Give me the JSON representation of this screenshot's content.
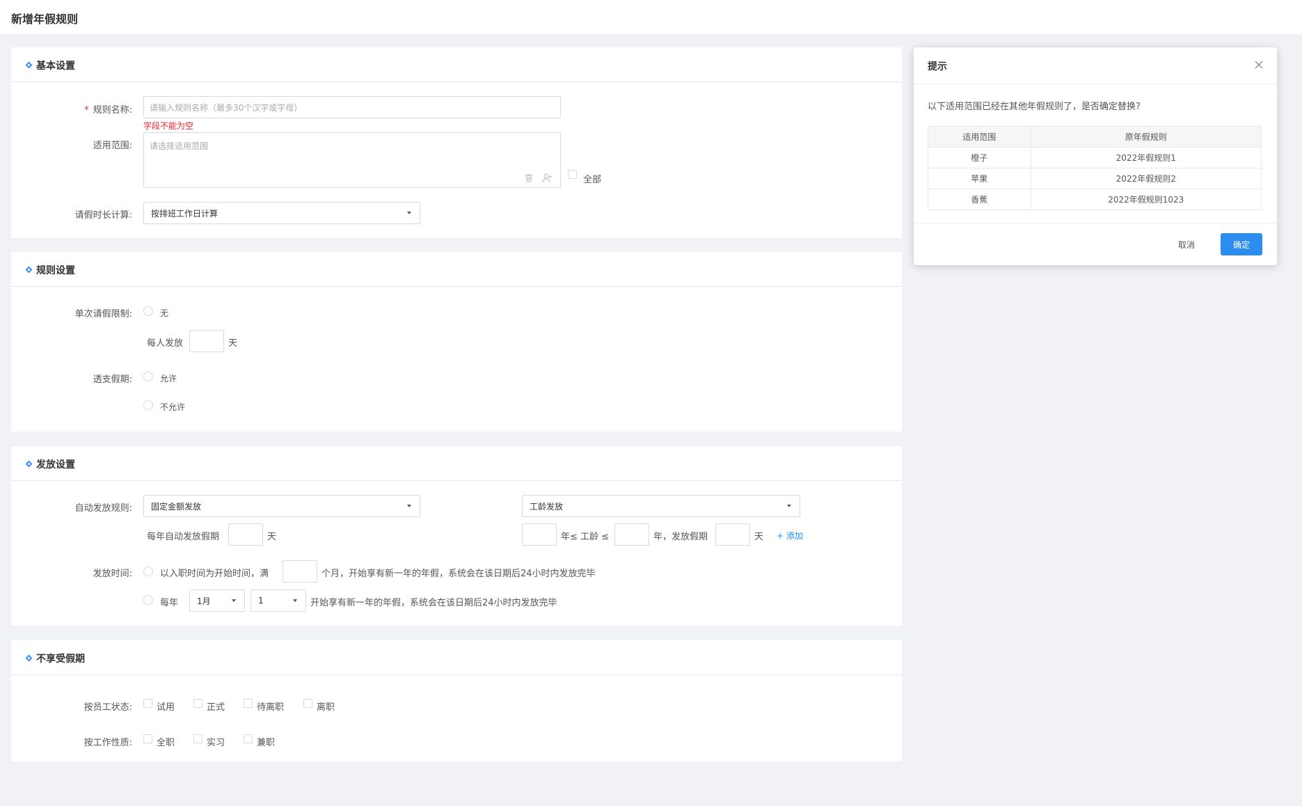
{
  "page": {
    "title": "新增年假规则"
  },
  "basic": {
    "title": "基本设置",
    "name_label": "规则名称:",
    "name_placeholder": "请输入规则名称（最多30个汉字或字母）",
    "name_error": "字段不能为空",
    "scope_label": "适用范围:",
    "scope_placeholder": "请选择适用范围",
    "all_label": "全部",
    "duration_label": "请假时长计算:",
    "duration_value": "按排班工作日计算"
  },
  "rules": {
    "title": "规则设置",
    "single_limit_label": "单次请假限制:",
    "single_none": "无",
    "per_person_prefix": "每人发放",
    "per_person_suffix": "天",
    "overdraft_label": "透支假期:",
    "overdraft_allow": "允许",
    "overdraft_deny": "不允许"
  },
  "issue": {
    "title": "发放设置",
    "auto_rule_label": "自动发放规则:",
    "auto_rule_value": "固定金额发放",
    "seniority_value": "工龄发放",
    "yearly_prefix": "每年自动发放假期",
    "yearly_suffix": "天",
    "seniority_year_le": "年≤ 工龄 ≤",
    "seniority_issue": "年，发放假期",
    "seniority_day": "天",
    "add_label": "+ 添加",
    "time_label": "发放时间:",
    "time_opt1_prefix": "以入职时间为开始时间，满",
    "time_opt1_suffix": "个月，开始享有新一年的年假，系统会在该日期后24小时内发放完毕",
    "time_opt2_prefix": "每年",
    "month_value": "1月",
    "day_value": "1",
    "time_opt2_suffix": "开始享有新一年的年假，系统会在该日期后24小时内发放完毕"
  },
  "exclude": {
    "title": "不享受假期",
    "status_label": "按员工状态:",
    "status_options": [
      "试用",
      "正式",
      "待离职",
      "离职"
    ],
    "nature_label": "按工作性质:",
    "nature_options": [
      "全职",
      "实习",
      "兼职"
    ]
  },
  "dialog": {
    "title": "提示",
    "message": "以下适用范围已经在其他年假规则了，是否确定替换?",
    "columns": [
      "适用范围",
      "原年假规则"
    ],
    "rows": [
      [
        "橙子",
        "2022年假规则1"
      ],
      [
        "苹果",
        "2022年假规则2"
      ],
      [
        "香蕉",
        "2022年假规则1023"
      ]
    ],
    "cancel_label": "取消",
    "ok_label": "确定"
  },
  "colors": {
    "primary": "#2d8cf0",
    "error": "#f5222d",
    "accent": "#3e8ef7"
  }
}
